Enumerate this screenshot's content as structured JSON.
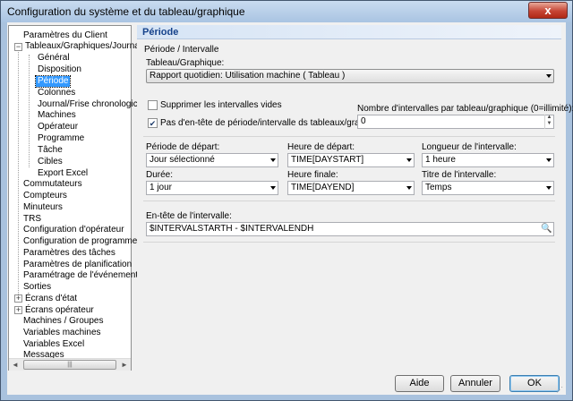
{
  "window": {
    "title": "Configuration du système et du tableau/graphique",
    "close_glyph": "x"
  },
  "tree": {
    "items": [
      {
        "label": "Paramètres du Client"
      },
      {
        "label": "Tableaux/Graphiques/Journa"
      },
      {
        "label": "Général"
      },
      {
        "label": "Disposition"
      },
      {
        "label": "Période"
      },
      {
        "label": "Colonnes"
      },
      {
        "label": "Journal/Frise chronologic"
      },
      {
        "label": "Machines"
      },
      {
        "label": "Opérateur"
      },
      {
        "label": "Programme"
      },
      {
        "label": "Tâche"
      },
      {
        "label": "Cibles"
      },
      {
        "label": "Export Excel"
      },
      {
        "label": "Commutateurs"
      },
      {
        "label": "Compteurs"
      },
      {
        "label": "Minuteurs"
      },
      {
        "label": "TRS"
      },
      {
        "label": "Configuration d'opérateur"
      },
      {
        "label": "Configuration de programme"
      },
      {
        "label": "Paramètres des tâches"
      },
      {
        "label": "Paramètres de planification"
      },
      {
        "label": "Paramétrage de l'événement"
      },
      {
        "label": "Sorties"
      },
      {
        "label": "Écrans d'état"
      },
      {
        "label": "Écrans opérateur"
      },
      {
        "label": "Machines / Groupes"
      },
      {
        "label": "Variables machines"
      },
      {
        "label": "Variables Excel"
      },
      {
        "label": "Messages"
      }
    ],
    "expand_minus": "−",
    "expand_plus": "+",
    "scroll_left": "◄",
    "scroll_right": "►",
    "thumb_grip": "|||"
  },
  "panel": {
    "header": "Période",
    "group_label": "Période / Intervalle",
    "tableau_label": "Tableau/Graphique:",
    "tableau_value": "Rapport quotidien: Utilisation machine  ( Tableau )",
    "suppress_label": "Supprimer les intervalles vides",
    "suppress_checked": false,
    "no_header_label": "Pas d'en-tête de période/intervalle ds tableaux/graphique",
    "no_header_checked": true,
    "check_mark": "✔",
    "nb_intervals_label": "Nombre d'intervalles par tableau/graphique (0=illimité):",
    "nb_intervals_value": "0",
    "spin_up": "▲",
    "spin_down": "▼",
    "start_period_label": "Période de départ:",
    "start_period_value": "Jour sélectionné",
    "start_time_label": "Heure de départ:",
    "start_time_value": "TIME[DAYSTART]",
    "interval_length_label": "Longueur de l'intervalle:",
    "interval_length_value": "1 heure",
    "duration_label": "Durée:",
    "duration_value": "1 jour",
    "end_time_label": "Heure finale:",
    "end_time_value": "TIME[DAYEND]",
    "interval_title_label": "Titre de l'intervalle:",
    "interval_title_value": "Temps",
    "interval_header_label": "En-tête de l'intervalle:",
    "interval_header_value": "$INTERVALSTARTH - $INTERVALENDH",
    "search_glyph": "🔍"
  },
  "buttons": {
    "help": "Aide",
    "cancel": "Annuler",
    "ok": "OK"
  },
  "resize_grip": "⋰"
}
